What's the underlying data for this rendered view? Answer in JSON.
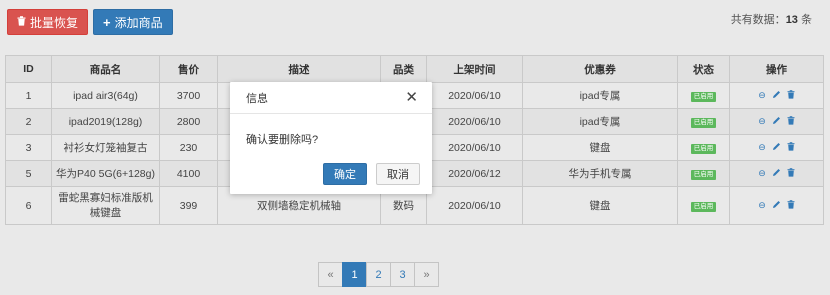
{
  "toolbar": {
    "batch_restore_label": "批量恢复",
    "add_product_label": "添加商品"
  },
  "count": {
    "label": "共有数据：",
    "value": "13",
    "unit": " 条"
  },
  "table": {
    "headers": [
      "ID",
      "商品名",
      "售价",
      "描述",
      "品类",
      "上架时间",
      "优惠券",
      "状态",
      "操作"
    ],
    "rows": [
      {
        "id": "1",
        "name": "ipad air3(64g)",
        "price": "3700",
        "desc": "",
        "category": "",
        "date": "2020/06/10",
        "coupon": "ipad专属",
        "status": "已启用"
      },
      {
        "id": "2",
        "name": "ipad2019(128g)",
        "price": "2800",
        "desc": "",
        "category": "",
        "date": "2020/06/10",
        "coupon": "ipad专属",
        "status": "已启用"
      },
      {
        "id": "3",
        "name": "衬衫女灯笼袖复古",
        "price": "230",
        "desc": "",
        "category": "",
        "date": "2020/06/10",
        "coupon": "键盘",
        "status": "已启用"
      },
      {
        "id": "5",
        "name": "华为P40 5G(6+128g)",
        "price": "4100",
        "desc": "",
        "category": "",
        "date": "2020/06/12",
        "coupon": "华为手机专属",
        "status": "已启用"
      },
      {
        "id": "6",
        "name": "雷蛇黑寡妇标准版机械键盘",
        "price": "399",
        "desc": "双侧墙稳定机械轴",
        "category": "数码",
        "date": "2020/06/10",
        "coupon": "键盘",
        "status": "已启用"
      }
    ]
  },
  "pagination": {
    "prev": "«",
    "pages": [
      "1",
      "2",
      "3"
    ],
    "next": "»",
    "current": "1"
  },
  "modal": {
    "title": "信息",
    "message": "确认要删除吗?",
    "ok_label": "确定",
    "cancel_label": "取消"
  },
  "colors": {
    "danger": "#d9534f",
    "primary": "#337ab7",
    "success": "#5cb85c"
  }
}
